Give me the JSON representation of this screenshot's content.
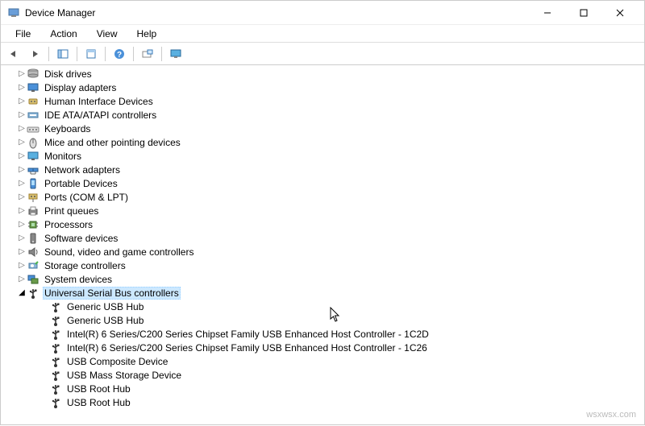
{
  "window": {
    "title": "Device Manager"
  },
  "menu": {
    "file": "File",
    "action": "Action",
    "view": "View",
    "help": "Help"
  },
  "tree": {
    "categories": [
      {
        "label": "Disk drives",
        "icon": "disk-icon",
        "expanded": false,
        "selected": false
      },
      {
        "label": "Display adapters",
        "icon": "display-icon",
        "expanded": false,
        "selected": false
      },
      {
        "label": "Human Interface Devices",
        "icon": "hid-icon",
        "expanded": false,
        "selected": false
      },
      {
        "label": "IDE ATA/ATAPI controllers",
        "icon": "ide-icon",
        "expanded": false,
        "selected": false
      },
      {
        "label": "Keyboards",
        "icon": "keyboard-icon",
        "expanded": false,
        "selected": false
      },
      {
        "label": "Mice and other pointing devices",
        "icon": "mouse-icon",
        "expanded": false,
        "selected": false
      },
      {
        "label": "Monitors",
        "icon": "monitor-icon",
        "expanded": false,
        "selected": false
      },
      {
        "label": "Network adapters",
        "icon": "network-icon",
        "expanded": false,
        "selected": false
      },
      {
        "label": "Portable Devices",
        "icon": "portable-icon",
        "expanded": false,
        "selected": false
      },
      {
        "label": "Ports (COM & LPT)",
        "icon": "ports-icon",
        "expanded": false,
        "selected": false
      },
      {
        "label": "Print queues",
        "icon": "printer-icon",
        "expanded": false,
        "selected": false
      },
      {
        "label": "Processors",
        "icon": "cpu-icon",
        "expanded": false,
        "selected": false
      },
      {
        "label": "Software devices",
        "icon": "software-icon",
        "expanded": false,
        "selected": false
      },
      {
        "label": "Sound, video and game controllers",
        "icon": "sound-icon",
        "expanded": false,
        "selected": false
      },
      {
        "label": "Storage controllers",
        "icon": "storage-icon",
        "expanded": false,
        "selected": false
      },
      {
        "label": "System devices",
        "icon": "system-icon",
        "expanded": false,
        "selected": false
      },
      {
        "label": "Universal Serial Bus controllers",
        "icon": "usb-icon",
        "expanded": true,
        "selected": true,
        "children": [
          {
            "label": "Generic USB Hub"
          },
          {
            "label": "Generic USB Hub"
          },
          {
            "label": "Intel(R) 6 Series/C200 Series Chipset Family USB Enhanced Host Controller - 1C2D"
          },
          {
            "label": "Intel(R) 6 Series/C200 Series Chipset Family USB Enhanced Host Controller - 1C26"
          },
          {
            "label": "USB Composite Device"
          },
          {
            "label": "USB Mass Storage Device"
          },
          {
            "label": "USB Root Hub"
          },
          {
            "label": "USB Root Hub"
          }
        ]
      }
    ]
  },
  "watermark": "wsxwsx.com"
}
